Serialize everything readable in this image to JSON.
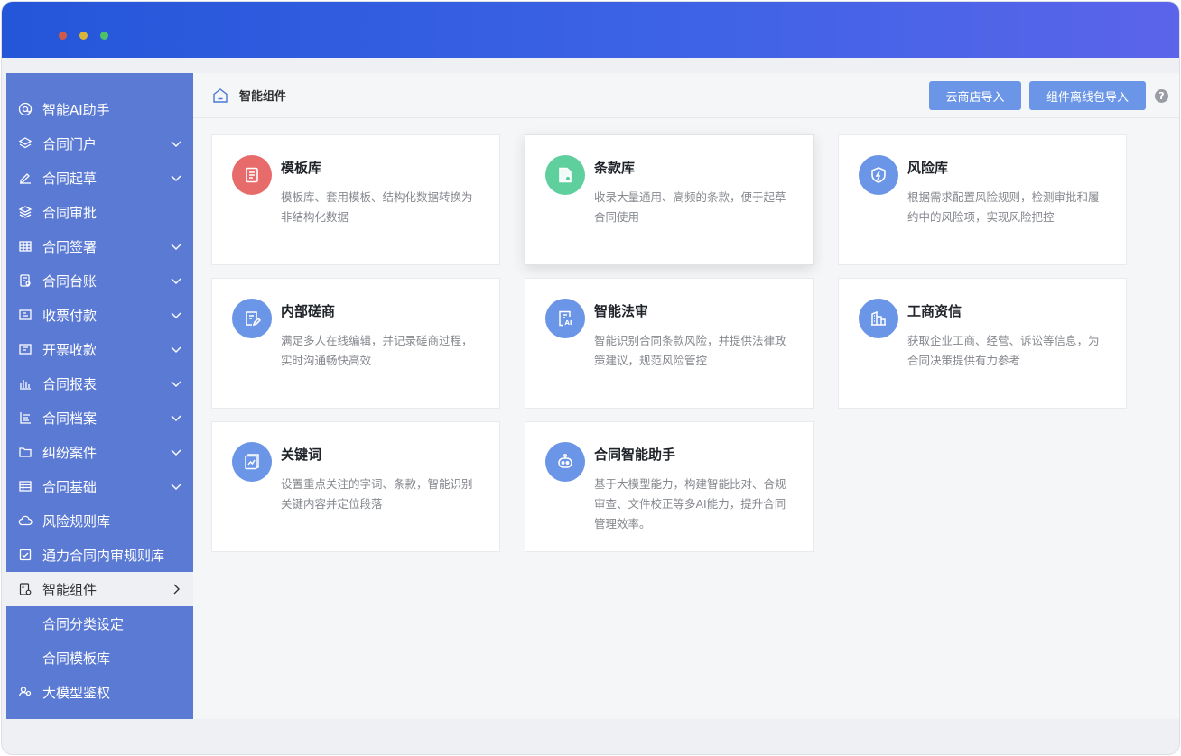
{
  "sidebar": {
    "items": [
      {
        "label": "智能AI助手",
        "icon": "at-icon"
      },
      {
        "label": "合同门户",
        "icon": "layers-icon"
      },
      {
        "label": "合同起草",
        "icon": "pen-icon"
      },
      {
        "label": "合同审批",
        "icon": "stack-icon"
      },
      {
        "label": "合同签署",
        "icon": "grid-icon"
      },
      {
        "label": "合同台账",
        "icon": "ledger-icon"
      },
      {
        "label": "收票付款",
        "icon": "invoice-icon"
      },
      {
        "label": "开票收款",
        "icon": "receipt-icon"
      },
      {
        "label": "合同报表",
        "icon": "bar-chart-icon"
      },
      {
        "label": "合同档案",
        "icon": "list-icon"
      },
      {
        "label": "纠纷案件",
        "icon": "folder-icon"
      },
      {
        "label": "合同基础",
        "icon": "table-icon"
      },
      {
        "label": "风险规则库",
        "icon": "cloud-icon"
      },
      {
        "label": "通力合同内审规则库",
        "icon": "checkbox-icon"
      },
      {
        "label": "智能组件",
        "icon": "ai-doc-icon"
      },
      {
        "label": "合同分类设定",
        "icon": ""
      },
      {
        "label": "合同模板库",
        "icon": ""
      },
      {
        "label": "大模型鉴权",
        "icon": "users-icon"
      }
    ]
  },
  "header": {
    "title": "智能组件",
    "cloud_import": "云商店导入",
    "offline_import": "组件离线包导入",
    "help": "?"
  },
  "cards": [
    {
      "title": "模板库",
      "desc": "模板库、套用模板、结构化数据转换为非结构化数据",
      "color": "#e86b6b",
      "icon": "document-icon"
    },
    {
      "title": "条款库",
      "desc": "收录大量通用、高频的条款，便于起草合同使用",
      "color": "#5fcf9e",
      "icon": "clause-file-icon"
    },
    {
      "title": "风险库",
      "desc": "根据需求配置风险规则，检测审批和履约中的风险项，实现风险把控",
      "color": "#6b95e6",
      "icon": "shield-icon"
    },
    {
      "title": "内部磋商",
      "desc": "满足多人在线编辑，并记录磋商过程，实时沟通畅快高效",
      "color": "#6b95e6",
      "icon": "edit-doc-icon"
    },
    {
      "title": "智能法审",
      "desc": "智能识别合同条款风险，并提供法律政策建议，规范风险管控",
      "color": "#6b95e6",
      "icon": "ai-review-icon"
    },
    {
      "title": "工商资信",
      "desc": "获取企业工商、经营、诉讼等信息，为合同决策提供有力参考",
      "color": "#6b95e6",
      "icon": "building-icon"
    },
    {
      "title": "关键词",
      "desc": "设置重点关注的字词、条款，智能识别关键内容并定位段落",
      "color": "#6b95e6",
      "icon": "keyword-icon"
    },
    {
      "title": "合同智能助手",
      "desc": "基于大模型能力，构建智能比对、合规审查、文件校正等多AI能力，提升合同管理效率。",
      "color": "#6b95e6",
      "icon": "robot-icon"
    }
  ]
}
